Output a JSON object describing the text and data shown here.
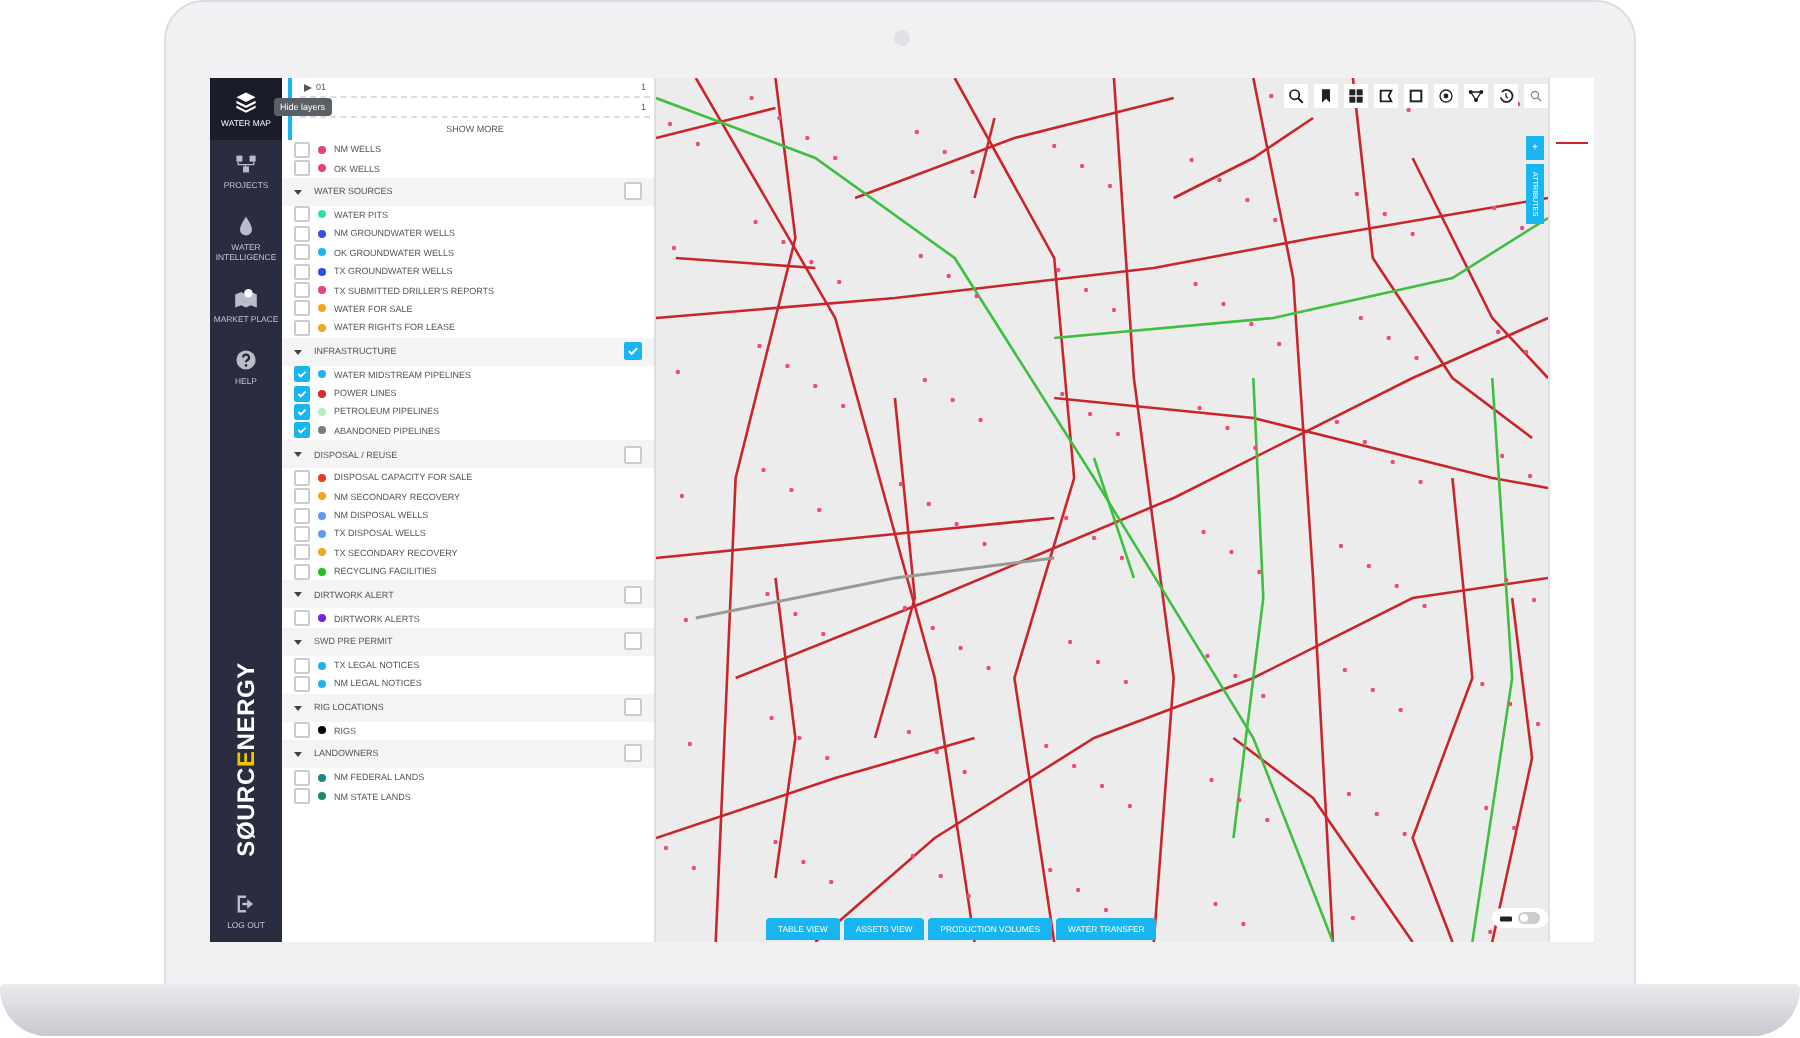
{
  "nav": {
    "items": [
      {
        "label": "WATER MAP",
        "selected": true
      },
      {
        "label": "PROJECTS",
        "selected": false
      },
      {
        "label": "WATER INTELLIGENCE",
        "selected": false
      },
      {
        "label": "MARKET PLACE",
        "selected": false
      },
      {
        "label": "HELP",
        "selected": false
      }
    ],
    "logo": {
      "before": "SØURC",
      "highlight": "E",
      "after": "NERGY"
    },
    "logout": "LOG OUT"
  },
  "tooltip": "Hide layers",
  "summary": {
    "rows": [
      {
        "label": "01",
        "count": "1"
      },
      {
        "label": "",
        "count": "1"
      }
    ],
    "show_more": "SHOW MORE"
  },
  "sections": [
    {
      "items": [
        {
          "label": "NM WELLS",
          "color": "#e8407a",
          "checked": false
        },
        {
          "label": "OK WELLS",
          "color": "#e8407a",
          "checked": false
        }
      ]
    },
    {
      "title": "WATER SOURCES",
      "checked": false,
      "items": [
        {
          "label": "WATER PITS",
          "color": "#2ee0b0",
          "checked": false
        },
        {
          "label": "NM GROUNDWATER WELLS",
          "color": "#3b4fe0",
          "checked": false
        },
        {
          "label": "OK GROUNDWATER WELLS",
          "color": "#19b5f0",
          "checked": false
        },
        {
          "label": "TX GROUNDWATER WELLS",
          "color": "#2f4ae8",
          "checked": false
        },
        {
          "label": "TX SUBMITTED DRILLER'S REPORTS",
          "color": "#e8407a",
          "checked": false
        },
        {
          "label": "WATER FOR SALE",
          "color": "#f2a81d",
          "checked": false
        },
        {
          "label": "WATER RIGHTS FOR LEASE",
          "color": "#f2a81d",
          "checked": false
        }
      ]
    },
    {
      "title": "INFRASTRUCTURE",
      "checked": true,
      "items": [
        {
          "label": "WATER MIDSTREAM PIPELINES",
          "color": "#19b5f0",
          "checked": true
        },
        {
          "label": "POWER LINES",
          "color": "#d42a2a",
          "checked": true
        },
        {
          "label": "PETROLEUM PIPELINES",
          "color": "#b8ecc8",
          "checked": true
        },
        {
          "label": "ABANDONED PIPELINES",
          "color": "#777b84",
          "checked": true
        }
      ]
    },
    {
      "title": "DISPOSAL / REUSE",
      "checked": false,
      "items": [
        {
          "label": "DISPOSAL CAPACITY FOR SALE",
          "color": "#e83a2a",
          "checked": false
        },
        {
          "label": "NM SECONDARY RECOVERY",
          "color": "#f2a81d",
          "checked": false
        },
        {
          "label": "NM DISPOSAL WELLS",
          "color": "#5b9cf0",
          "checked": false
        },
        {
          "label": "TX DISPOSAL WELLS",
          "color": "#5b9cf0",
          "checked": false
        },
        {
          "label": "TX SECONDARY RECOVERY",
          "color": "#f2a81d",
          "checked": false
        },
        {
          "label": "RECYCLING FACILITIES",
          "color": "#1fc21f",
          "checked": false
        }
      ]
    },
    {
      "title": "DIRTWORK ALERT",
      "checked": false,
      "items": [
        {
          "label": "DIRTWORK ALERTS",
          "color": "#7a1fe0",
          "checked": false
        }
      ]
    },
    {
      "title": "SWD PRE PERMIT",
      "checked": false,
      "items": [
        {
          "label": "TX LEGAL NOTICES",
          "color": "#19b5f0",
          "checked": false
        },
        {
          "label": "NM LEGAL NOTICES",
          "color": "#19b5f0",
          "checked": false
        }
      ]
    },
    {
      "title": "RIG LOCATIONS",
      "checked": false,
      "items": [
        {
          "label": "RIGS",
          "color": "#000000",
          "checked": false
        }
      ]
    },
    {
      "title": "LANDOWNERS",
      "checked": false,
      "items": [
        {
          "label": "NM FEDERAL LANDS",
          "color": "#1a8a86",
          "checked": false
        },
        {
          "label": "NM STATE LANDS",
          "color": "#1a8a6a",
          "checked": false
        }
      ]
    }
  ],
  "attributes_tab": {
    "plus": "+",
    "label": "ATTRIBUTES"
  },
  "bottom_tabs": [
    {
      "label": "TABLE VIEW"
    },
    {
      "label": "ASSETS VIEW"
    },
    {
      "label": "PRODUCTION VOLUMES"
    },
    {
      "label": "WATER TRANSFER"
    }
  ],
  "basemap_toggle": {
    "on": false
  }
}
